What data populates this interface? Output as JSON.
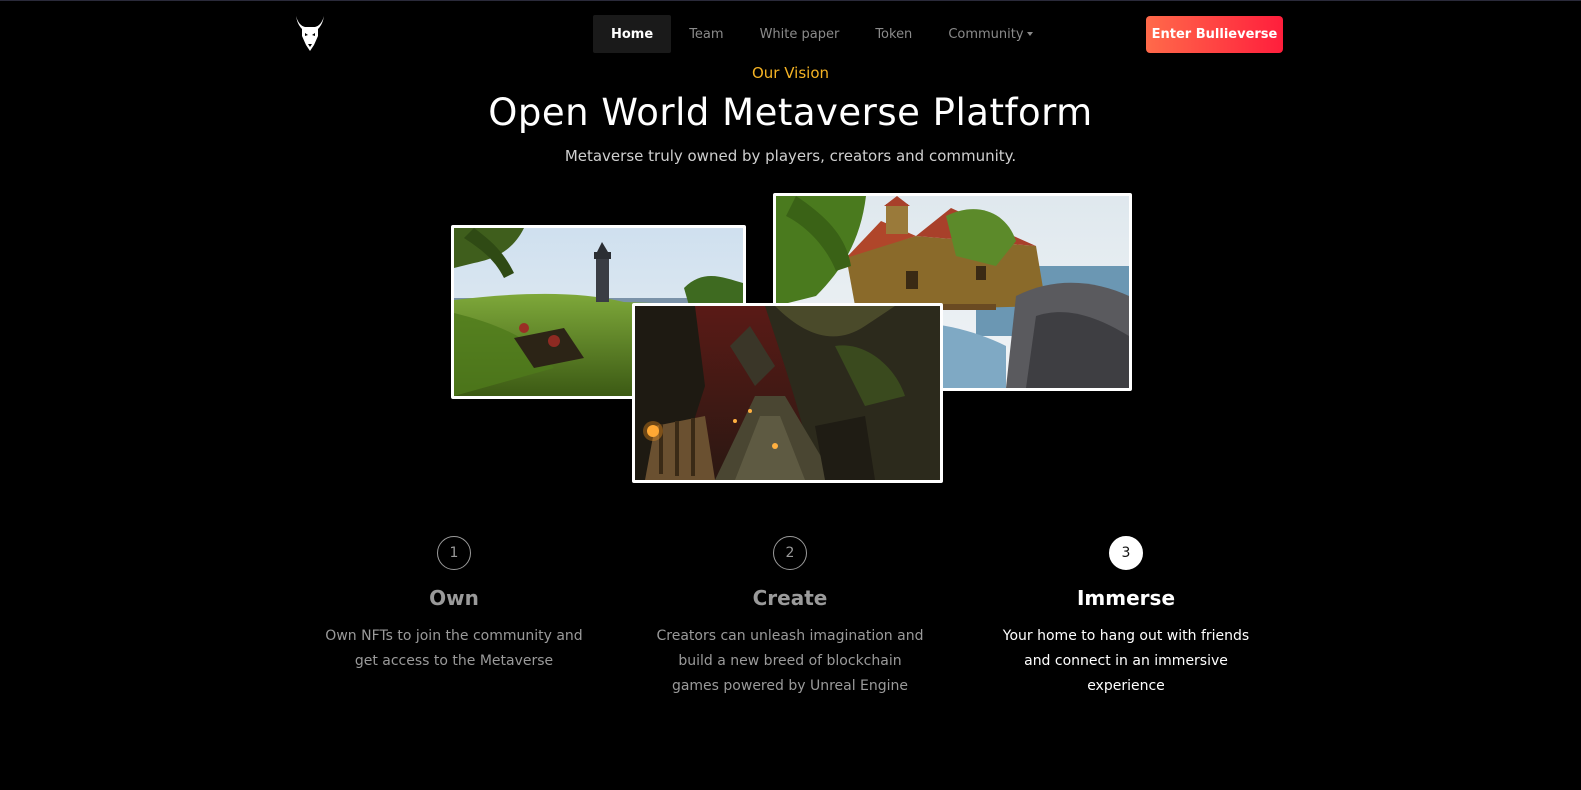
{
  "nav": {
    "logo_icon": "bull-head-logo",
    "items": [
      {
        "label": "Home",
        "active": true
      },
      {
        "label": "Team",
        "active": false
      },
      {
        "label": "White paper",
        "active": false
      },
      {
        "label": "Token",
        "active": false
      },
      {
        "label": "Community",
        "active": false
      }
    ],
    "cta_label": "Enter Bullieverse"
  },
  "hero": {
    "eyebrow": "Our Vision",
    "title": "Open World Metaverse Platform",
    "subtitle": "Metaverse truly owned by players, creators and community."
  },
  "gallery": {
    "images": [
      "lighthouse-scene",
      "village-coast-scene",
      "dungeon-path-scene"
    ]
  },
  "features": [
    {
      "step": "1",
      "title": "Own",
      "text": "Own NFTs to join the community and get access to the Metaverse",
      "active": false
    },
    {
      "step": "2",
      "title": "Create",
      "text": "Creators can unleash imagination and build a new breed of blockchain games powered by Unreal Engine",
      "active": false
    },
    {
      "step": "3",
      "title": "Immerse",
      "text": "Your home to hang out with friends and connect in an immersive experience",
      "active": true
    }
  ],
  "colors": {
    "background": "#000000",
    "accent_gold": "#f5b324",
    "cta_gradient_start": "#ff6a4a",
    "cta_gradient_end": "#ff1e3c",
    "muted_text": "#9a9a9a"
  }
}
